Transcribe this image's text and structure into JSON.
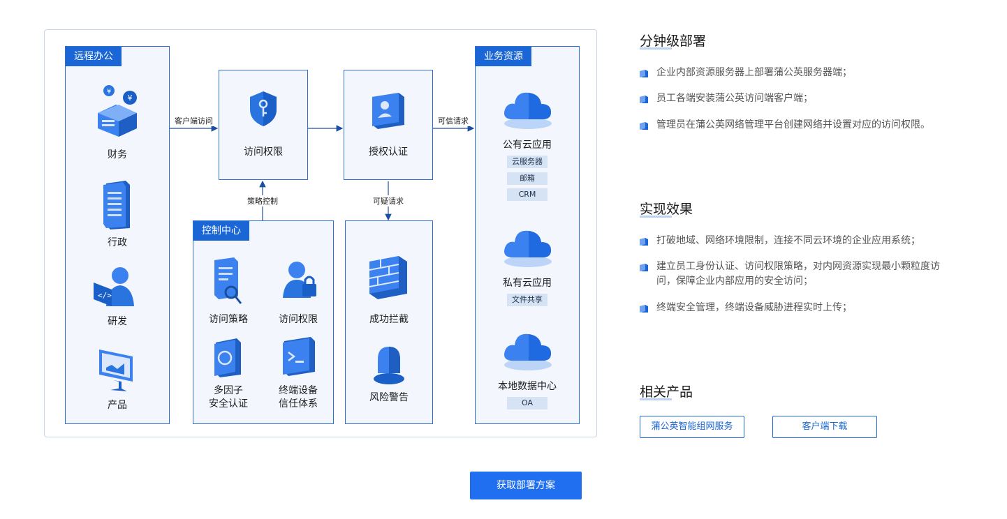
{
  "diagram": {
    "remote_office": {
      "title": "远程办公",
      "items": [
        "财务",
        "行政",
        "研发",
        "产品"
      ]
    },
    "access_box": {
      "label": "访问权限"
    },
    "auth_box": {
      "label": "授权认证"
    },
    "control_center": {
      "title": "控制中心",
      "items": [
        "访问策略",
        "访问权限",
        "多因子\n安全认证",
        "终端设备\n信任体系"
      ]
    },
    "intercept_box": {
      "items": [
        "成功拦截",
        "风险警告"
      ]
    },
    "business_resources": {
      "title": "业务资源",
      "groups": [
        {
          "label": "公有云应用",
          "tags": [
            "云服务器",
            "邮箱",
            "CRM"
          ]
        },
        {
          "label": "私有云应用",
          "tags": [
            "文件共享"
          ]
        },
        {
          "label": "本地数据中心",
          "tags": [
            "OA"
          ]
        }
      ]
    },
    "arrows": {
      "client_access": "客户端访问",
      "trusted_request": "可信请求",
      "policy_control": "策略控制",
      "suspicious_request": "可疑请求"
    }
  },
  "sections": [
    {
      "title": "分钟级部署",
      "bullets": [
        "企业内部资源服务器上部署蒲公英服务器端；",
        "员工各端安装蒲公英访问端客户端；",
        "管理员在蒲公英网络管理平台创建网络并设置对应的访问权限。"
      ]
    },
    {
      "title": "实现效果",
      "bullets": [
        "打破地域、网络环境限制，连接不同云环境的企业应用系统；",
        "建立员工身份认证、访问权限策略，对内网资源实现最小颗粒度访\n问，保障企业内部应用的安全访问；",
        "终端安全管理，终端设备威胁进程实时上传；"
      ]
    },
    {
      "title": "相关产品",
      "buttons": [
        "蒲公英智能组网服务",
        "客户端下载"
      ]
    }
  ],
  "cta_label": "获取部署方案",
  "colors": {
    "primary": "#1a66d6",
    "cta": "#1f6ff0",
    "panel_bg": "#f3f7fd"
  }
}
